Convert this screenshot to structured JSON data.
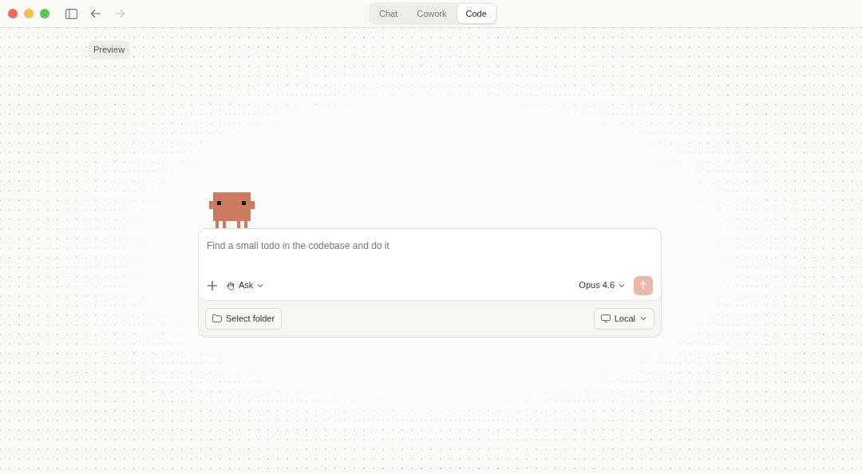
{
  "window": {
    "nav": {
      "back_disabled": false,
      "forward_disabled": true
    }
  },
  "mode_tabs": [
    {
      "label": "Chat",
      "selected": false
    },
    {
      "label": "Cowork",
      "selected": false
    },
    {
      "label": "Code",
      "selected": true
    }
  ],
  "badge": "Preview",
  "composer": {
    "placeholder": "Find a small todo in the codebase and do it",
    "mode": "Ask",
    "model": "Opus 4.6",
    "send_disabled": true
  },
  "footer": {
    "folder_button": "Select folder",
    "environment": "Local"
  }
}
